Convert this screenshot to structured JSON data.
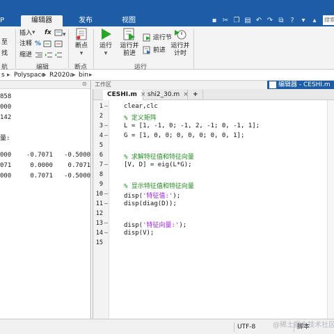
{
  "tabs": {
    "partial_left": "P",
    "editor": "编辑器",
    "publish": "发布",
    "view": "视图"
  },
  "search": {
    "placeholder": "搜索文档"
  },
  "toolstrip": {
    "insert": "插入",
    "fx": "fx",
    "comment": "注释",
    "percent": "%",
    "indent": "缩进",
    "goto_partial": "至",
    "find_partial": "找",
    "edit_section": "编辑",
    "breakpoints": "断点",
    "breakpoints_section": "断点",
    "run": "运行",
    "run_advance_1": "运行并",
    "run_advance_2": "前进",
    "run_section": "运行节",
    "advance": "前进",
    "run_time_1": "运行并",
    "run_time_2": "计时",
    "run_group": "运行",
    "partial_section_left": "航"
  },
  "address": {
    "prefix": "s",
    "sep": "▸",
    "parts": [
      "Polyspace",
      "R2020a",
      "bin"
    ]
  },
  "command_window": {
    "lines": [
      {
        "text": "858"
      },
      {
        "text": "000"
      },
      {
        "text": "142"
      },
      {
        "text": "量:"
      },
      {
        "text": "000    -0.7071   -0.5000"
      },
      {
        "text": "071     0.0000    0.7071"
      },
      {
        "text": "000     0.7071   -0.5000"
      }
    ]
  },
  "workspace": {
    "label": "工作区"
  },
  "editor": {
    "title": "编辑器 - CESHI.m",
    "tabs": [
      {
        "label": "CESHI.m",
        "active": true
      },
      {
        "label": "shi2_30.m",
        "active": false
      }
    ],
    "add_tab": "+",
    "lines": [
      {
        "n": "1",
        "dash": "—",
        "code": "clear,clc",
        "kind": "code"
      },
      {
        "n": "2",
        "dash": "",
        "code": "% 定义矩阵",
        "kind": "cmt"
      },
      {
        "n": "3",
        "dash": "—",
        "code": "L = [1, -1, 0; -1, 2, -1; 0, -1, 1];",
        "kind": "code"
      },
      {
        "n": "4",
        "dash": "—",
        "code": "G = [1, 0, 0; 0, 0, 0; 0, 0, 1];",
        "kind": "code"
      },
      {
        "n": "5",
        "dash": "",
        "code": "",
        "kind": "code"
      },
      {
        "n": "6",
        "dash": "",
        "code": "% 求解特征值和特征向量",
        "kind": "cmt"
      },
      {
        "n": "7",
        "dash": "—",
        "code": "[V, D] = eig(L*G);",
        "kind": "code"
      },
      {
        "n": "8",
        "dash": "",
        "code": "",
        "kind": "code"
      },
      {
        "n": "9",
        "dash": "",
        "code": "% 显示特征值和特征向量",
        "kind": "cmt"
      },
      {
        "n": "10",
        "dash": "—",
        "pre": "disp(",
        "str": "'特征值:'",
        "post": ");",
        "kind": "mixed"
      },
      {
        "n": "11",
        "dash": "—",
        "code": "disp(diag(D));",
        "kind": "code"
      },
      {
        "n": "12",
        "dash": "",
        "code": "",
        "kind": "code"
      },
      {
        "n": "13",
        "dash": "—",
        "pre": "disp(",
        "str": "'特征向量:'",
        "post": ");",
        "kind": "mixed"
      },
      {
        "n": "14",
        "dash": "—",
        "code": "disp(V);",
        "kind": "code"
      },
      {
        "n": "15",
        "dash": "",
        "code": "",
        "kind": "code"
      }
    ]
  },
  "status": {
    "encoding": "UTF-8",
    "filetype": "脚本"
  },
  "watermark": "@稀土掘金技术社区",
  "colors": {
    "accent": "#1c5da6",
    "comment": "#228b22",
    "string": "#a020f0"
  }
}
